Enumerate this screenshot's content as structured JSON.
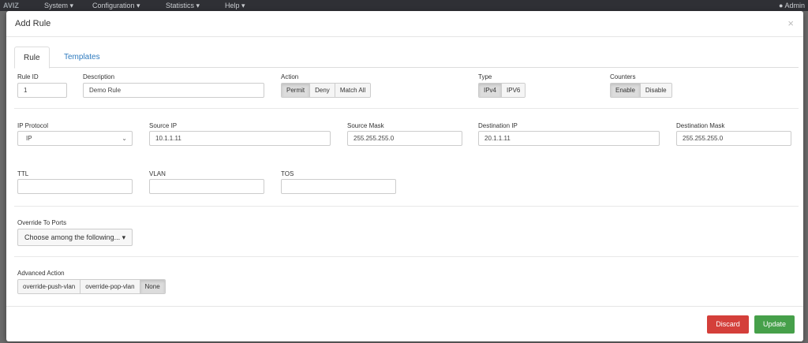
{
  "navbar": {
    "logo": "AVIZ",
    "items": [
      "System ▾",
      "Configuration ▾",
      "Statistics ▾",
      "Help ▾"
    ],
    "user": "Admin"
  },
  "modal": {
    "title": "Add Rule",
    "close_glyph": "×"
  },
  "tabs": [
    "Rule",
    "Templates"
  ],
  "fields": {
    "rule_id": {
      "label": "Rule ID",
      "value": "1"
    },
    "description": {
      "label": "Description",
      "value": "Demo Rule"
    },
    "action": {
      "label": "Action",
      "options": [
        "Permit",
        "Deny",
        "Match All"
      ],
      "selected": "Permit"
    },
    "type": {
      "label": "Type",
      "options": [
        "IPv4",
        "IPV6"
      ],
      "selected": "IPv4"
    },
    "counters": {
      "label": "Counters",
      "options": [
        "Enable",
        "Disable"
      ],
      "selected": "Enable"
    },
    "ip_protocol": {
      "label": "IP Protocol",
      "value": "IP"
    },
    "source_ip": {
      "label": "Source IP",
      "value": "10.1.1.11"
    },
    "source_mask": {
      "label": "Source Mask",
      "value": "255.255.255.0"
    },
    "destination_ip": {
      "label": "Destination IP",
      "value": "20.1.1.11"
    },
    "destination_mask": {
      "label": "Destination Mask",
      "value": "255.255.255.0"
    },
    "ttl": {
      "label": "TTL",
      "value": ""
    },
    "vlan": {
      "label": "VLAN",
      "value": ""
    },
    "tos": {
      "label": "TOS",
      "value": ""
    },
    "override_ports": {
      "label": "Override To Ports",
      "value": "Choose among the following... ▾"
    },
    "advanced_action": {
      "label": "Advanced Action",
      "options": [
        "override-push-vlan",
        "override-pop-vlan",
        "None"
      ],
      "selected": "None"
    }
  },
  "footer": {
    "discard_label": "Discard",
    "update_label": "Update"
  },
  "colors": {
    "discard": "#d43f3a",
    "update": "#46a04a",
    "link": "#2e7bbf"
  }
}
